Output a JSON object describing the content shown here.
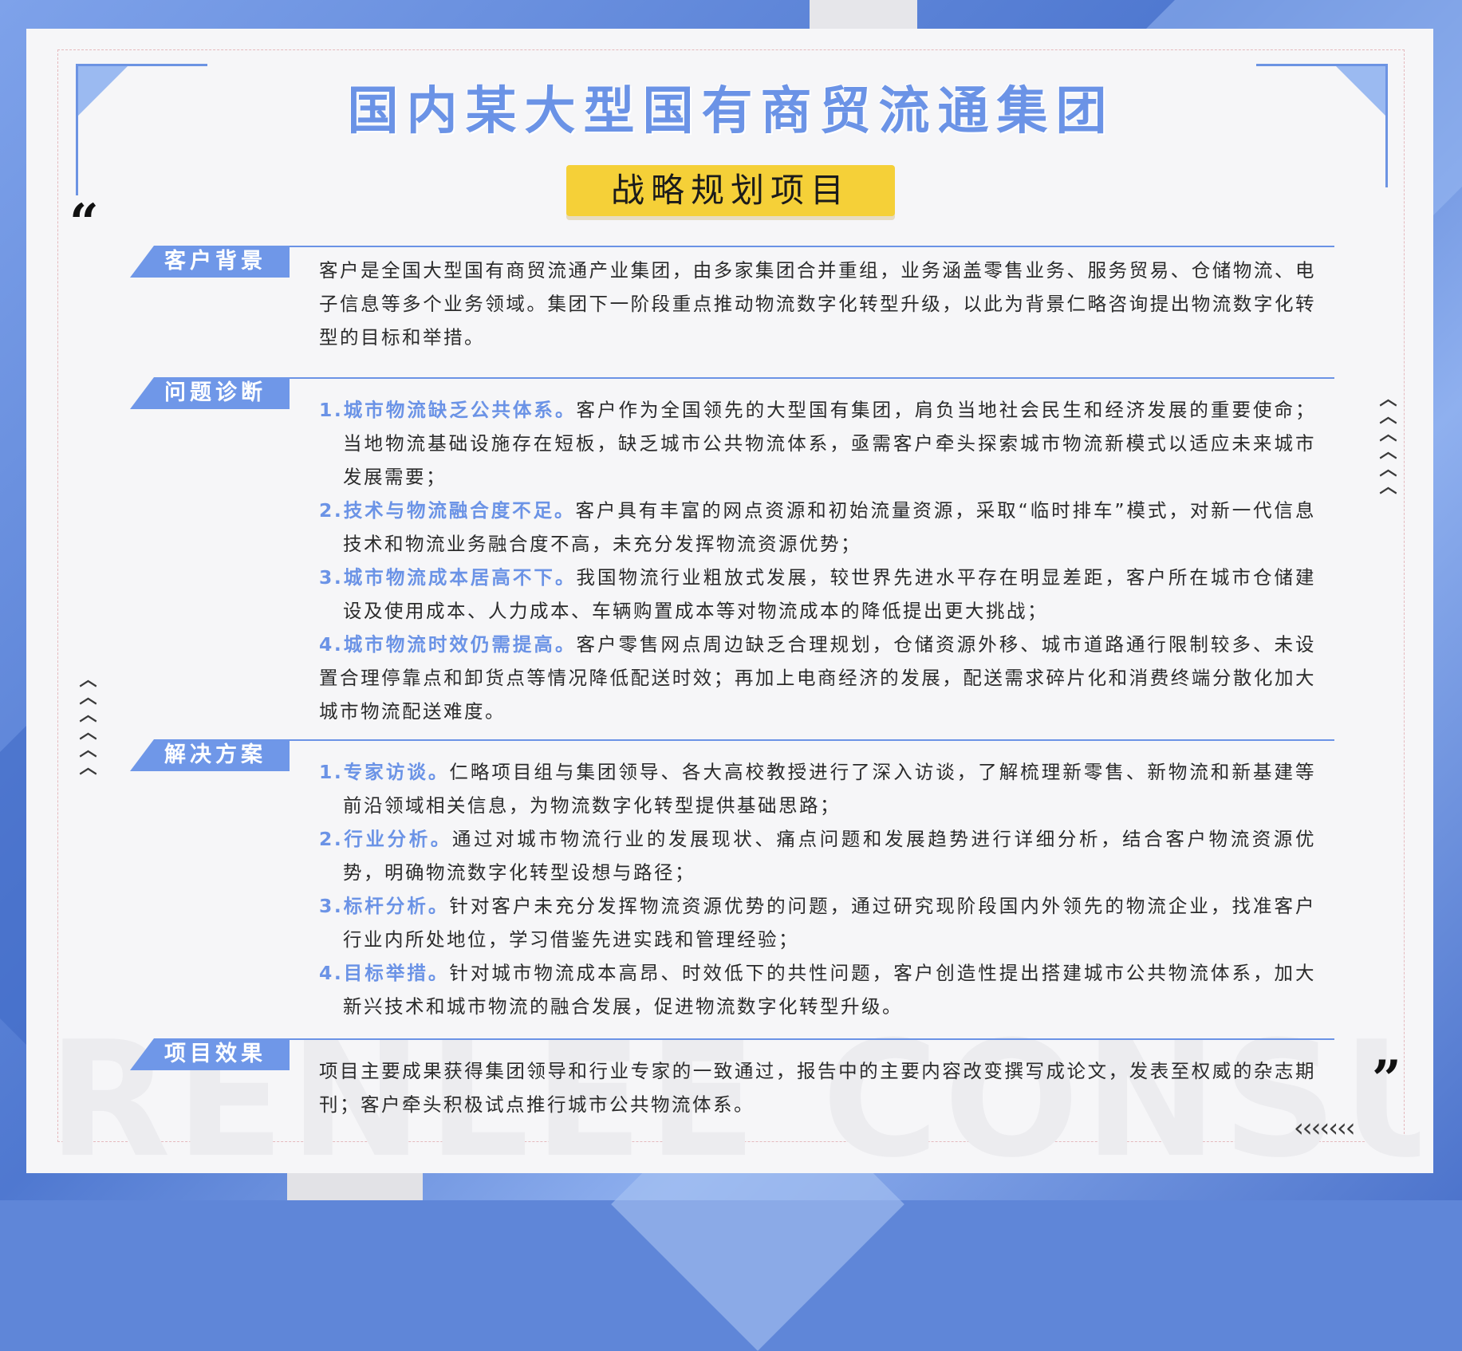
{
  "title": "国内某大型国有商贸流通集团",
  "subtitle": "战略规划项目",
  "quote_open": "“",
  "quote_close": "”",
  "watermark": "RENLEE CONSULTING",
  "chevrons_vertical": "︿︿︿︿︿︿",
  "chevrons_row": "‹‹‹‹‹‹‹",
  "sections": [
    {
      "label": "客户背景",
      "text": "客户是全国大型国有商贸流通产业集团，由多家集团合并重组，业务涵盖零售业务、服务贸易、仓储物流、电子信息等多个业务领域。集团下一阶段重点推动物流数字化转型升级，以此为背景仁略咨询提出物流数字化转型的目标和举措。"
    },
    {
      "label": "问题诊断",
      "items": [
        {
          "head": "1.城市物流缺乏公共体系。",
          "text": "客户作为全国领先的大型国有集团，肩负当地社会民生和经济发展的重要使命；当地物流基础设施存在短板，缺乏城市公共物流体系，亟需客户牵头探索城市物流新模式以适应未来城市发展需要；"
        },
        {
          "head": "2.技术与物流融合度不足。",
          "text": "客户具有丰富的网点资源和初始流量资源，采取“临时排车”模式，对新一代信息技术和物流业务融合度不高，未充分发挥物流资源优势；"
        },
        {
          "head": "3.城市物流成本居高不下。",
          "text": "我国物流行业粗放式发展，较世界先进水平存在明显差距，客户所在城市仓储建设及使用成本、人力成本、车辆购置成本等对物流成本的降低提出更大挑战；"
        },
        {
          "head": "4.城市物流时效仍需提高。",
          "text": "客户零售网点周边缺乏合理规划，仓储资源外移、城市道路通行限制较多、未设置合理停靠点和卸货点等情况降低配送时效；再加上电商经济的发展，配送需求碎片化和消费终端分散化加大城市物流配送难度。"
        }
      ]
    },
    {
      "label": "解决方案",
      "items": [
        {
          "head": "1.专家访谈。",
          "text": "仁略项目组与集团领导、各大高校教授进行了深入访谈，了解梳理新零售、新物流和新基建等前沿领域相关信息，为物流数字化转型提供基础思路；"
        },
        {
          "head": "2.行业分析。",
          "text": "通过对城市物流行业的发展现状、痛点问题和发展趋势进行详细分析，结合客户物流资源优势，明确物流数字化转型设想与路径；"
        },
        {
          "head": "3.标杆分析。",
          "text": "针对客户未充分发挥物流资源优势的问题，通过研究现阶段国内外领先的物流企业，找准客户行业内所处地位，学习借鉴先进实践和管理经验；"
        },
        {
          "head": "4.目标举措。",
          "text": "针对城市物流成本高昂、时效低下的共性问题，客户创造性提出搭建城市公共物流体系，加大新兴技术和城市物流的融合发展，促进物流数字化转型升级。"
        }
      ]
    },
    {
      "label": "项目效果",
      "text": "项目主要成果获得集团领导和行业专家的一致通过，报告中的主要内容改变撰写成论文，发表至权威的杂志期刊；客户牵头积极试点推行城市公共物流体系。"
    }
  ]
}
